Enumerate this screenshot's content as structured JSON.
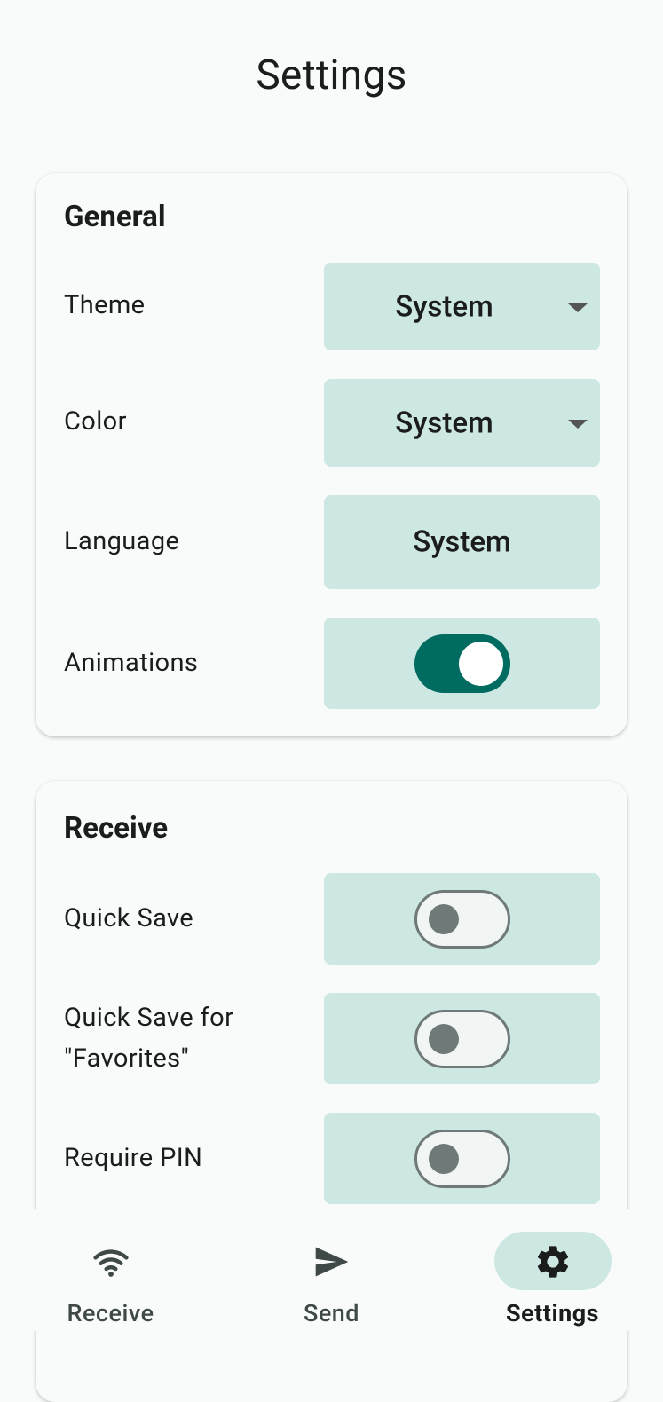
{
  "page": {
    "title": "Settings"
  },
  "general": {
    "title": "General",
    "theme": {
      "label": "Theme",
      "value": "System"
    },
    "color": {
      "label": "Color",
      "value": "System"
    },
    "language": {
      "label": "Language",
      "value": "System"
    },
    "animations": {
      "label": "Animations",
      "enabled": true
    }
  },
  "receive": {
    "title": "Receive",
    "quick_save": {
      "label": "Quick Save",
      "enabled": false
    },
    "quick_save_favorites": {
      "label_line1": "Quick Save for",
      "label_line2": "\"Favorites\"",
      "enabled": false
    },
    "require_pin": {
      "label": "Require PIN",
      "enabled": false
    }
  },
  "nav": {
    "items": [
      {
        "label": "Receive",
        "icon": "wifi-icon",
        "active": false
      },
      {
        "label": "Send",
        "icon": "send-icon",
        "active": false
      },
      {
        "label": "Settings",
        "icon": "gear-icon",
        "active": true
      }
    ]
  },
  "colors": {
    "accent": "#006b60",
    "control_bg": "#cde7e3",
    "background": "#f8fbfa"
  }
}
